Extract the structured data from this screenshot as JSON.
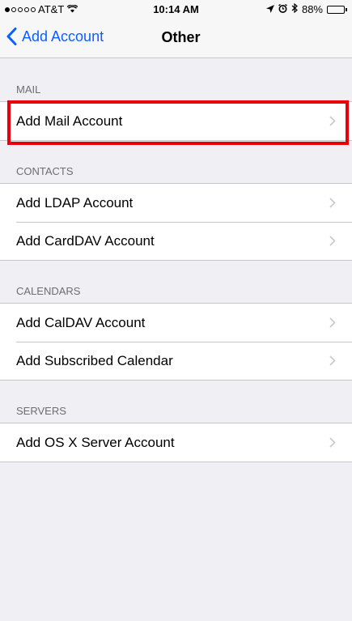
{
  "status_bar": {
    "carrier": "AT&T",
    "time": "10:14 AM",
    "battery": "88%",
    "battery_level": 0.88
  },
  "nav": {
    "back_label": "Add Account",
    "title": "Other"
  },
  "sections": {
    "mail": {
      "header": "MAIL",
      "items": [
        "Add Mail Account"
      ]
    },
    "contacts": {
      "header": "CONTACTS",
      "items": [
        "Add LDAP Account",
        "Add CardDAV Account"
      ]
    },
    "calendars": {
      "header": "CALENDARS",
      "items": [
        "Add CalDAV Account",
        "Add Subscribed Calendar"
      ]
    },
    "servers": {
      "header": "SERVERS",
      "items": [
        "Add OS X Server Account"
      ]
    }
  },
  "colors": {
    "accent": "#0a60fe",
    "highlight": "#e8000b",
    "background": "#efeff4"
  },
  "icons": [
    "wifi-icon",
    "location-arrow-icon",
    "alarm-icon",
    "bluetooth-icon",
    "battery-icon",
    "back-chevron-icon",
    "disclosure-chevron-icon"
  ]
}
